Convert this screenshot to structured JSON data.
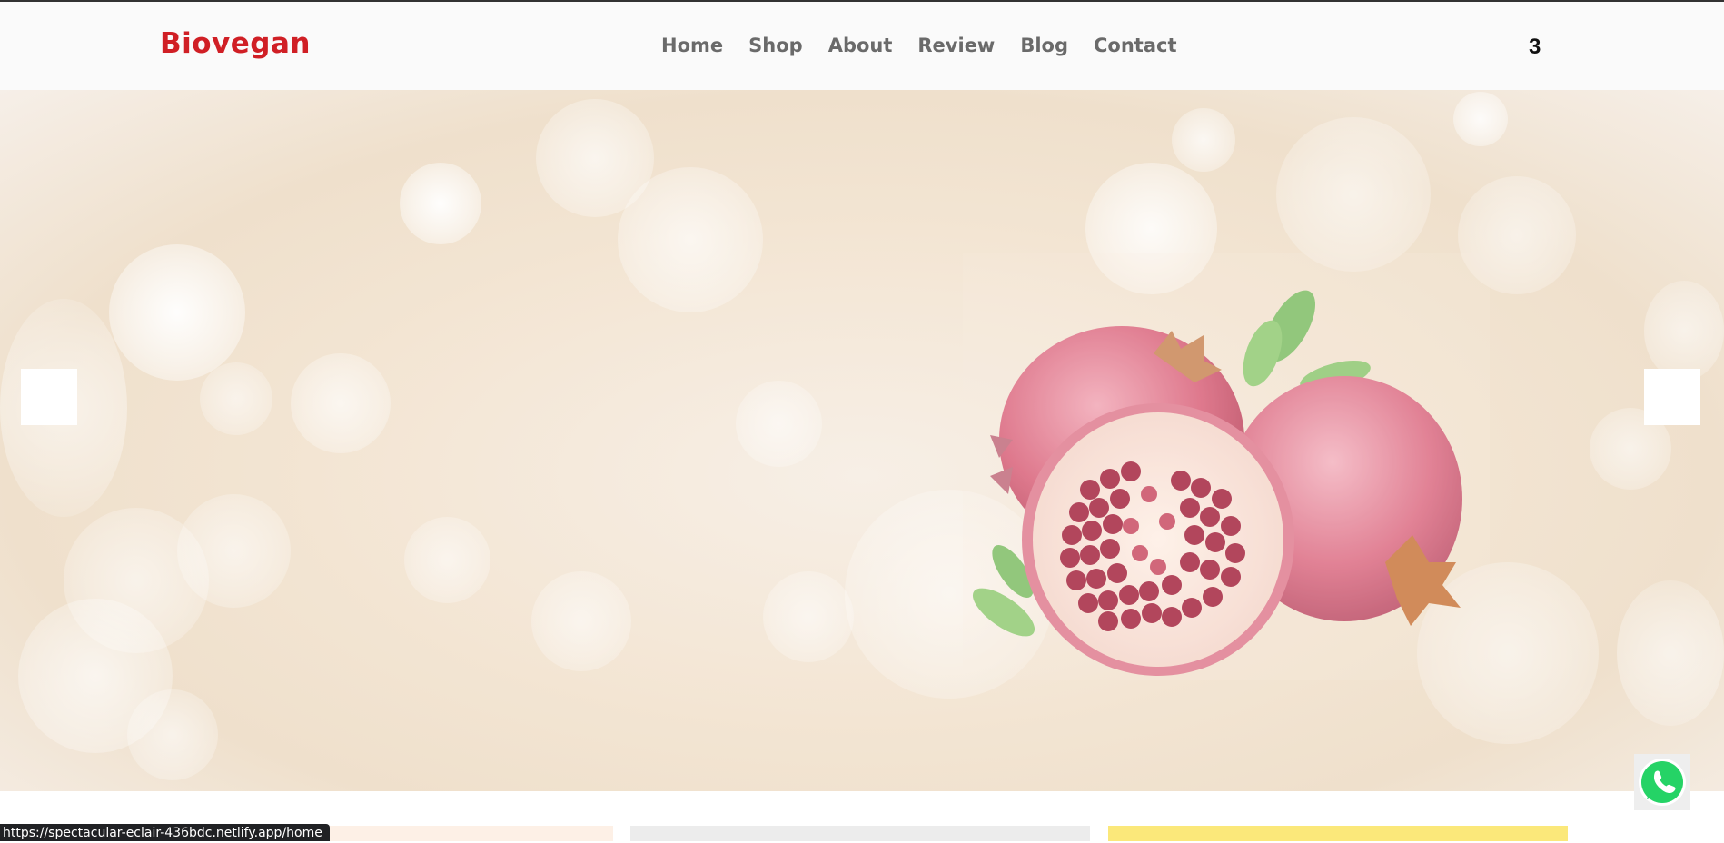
{
  "header": {
    "brand": "Biovegan",
    "nav": [
      "Home",
      "Shop",
      "About",
      "Review",
      "Blog",
      "Contact"
    ],
    "cart_count": "3"
  },
  "hero": {
    "prev_icon": "arrow-left-icon",
    "next_icon": "arrow-right-icon",
    "image": "pomegranate-image"
  },
  "status_bar": {
    "url": "https://spectacular-eclair-436bdc.netlify.app/home"
  },
  "colors": {
    "brand": "#d01f25",
    "nav_text": "#6a6a6a",
    "whatsapp": "#25d366"
  },
  "icons": {
    "whatsapp": "whatsapp-icon"
  }
}
